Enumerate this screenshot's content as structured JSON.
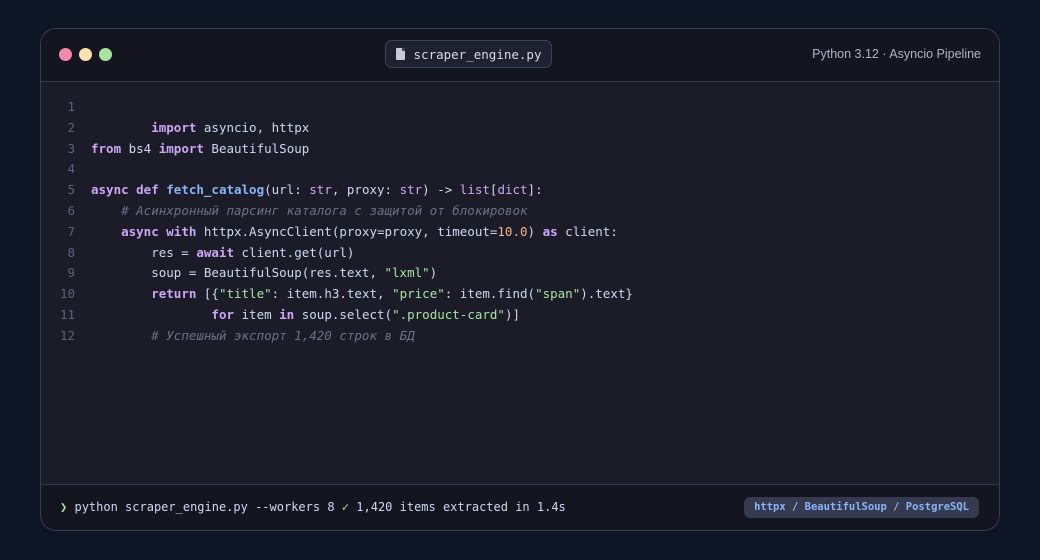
{
  "window": {
    "controls": {
      "close_color": "#f38ba8",
      "minimize_color": "#f9e2af",
      "maximize_color": "#a6e3a1"
    },
    "tab": {
      "icon": "file-icon",
      "filename": "scraper_engine.py"
    },
    "runtime_label": "Python 3.12 · Asyncio Pipeline"
  },
  "editor": {
    "lines": [
      {
        "n": "1",
        "tokens": []
      },
      {
        "n": "2",
        "tokens": [
          {
            "t": "        "
          },
          {
            "t": "import",
            "c": "kw"
          },
          {
            "t": " asyncio, httpx"
          }
        ]
      },
      {
        "n": "3",
        "tokens": [
          {
            "t": "from",
            "c": "kw"
          },
          {
            "t": " bs4 "
          },
          {
            "t": "import",
            "c": "kw"
          },
          {
            "t": " BeautifulSoup"
          }
        ]
      },
      {
        "n": "4",
        "tokens": []
      },
      {
        "n": "5",
        "tokens": [
          {
            "t": "async def",
            "c": "kw"
          },
          {
            "t": " "
          },
          {
            "t": "fetch_catalog",
            "c": "fn"
          },
          {
            "t": "(url: "
          },
          {
            "t": "str",
            "c": "ty"
          },
          {
            "t": ", proxy: "
          },
          {
            "t": "str",
            "c": "ty"
          },
          {
            "t": ") -> "
          },
          {
            "t": "list",
            "c": "ty"
          },
          {
            "t": "["
          },
          {
            "t": "dict",
            "c": "ty"
          },
          {
            "t": "]:"
          }
        ]
      },
      {
        "n": "6",
        "tokens": [
          {
            "t": "    "
          },
          {
            "t": "# Асинхронный парсинг каталога с защитой от блокировок",
            "c": "cmt"
          }
        ]
      },
      {
        "n": "7",
        "tokens": [
          {
            "t": "    "
          },
          {
            "t": "async with",
            "c": "kw"
          },
          {
            "t": " httpx.AsyncClient(proxy=proxy, timeout="
          },
          {
            "t": "10.0",
            "c": "num"
          },
          {
            "t": ") "
          },
          {
            "t": "as",
            "c": "kw"
          },
          {
            "t": " client:"
          }
        ]
      },
      {
        "n": "8",
        "tokens": [
          {
            "t": "        res = "
          },
          {
            "t": "await",
            "c": "kw"
          },
          {
            "t": " client.get(url)"
          }
        ]
      },
      {
        "n": "9",
        "tokens": [
          {
            "t": "        soup = BeautifulSoup(res.text, "
          },
          {
            "t": "\"lxml\"",
            "c": "str"
          },
          {
            "t": ")"
          }
        ]
      },
      {
        "n": "10",
        "tokens": [
          {
            "t": "        "
          },
          {
            "t": "return",
            "c": "kw"
          },
          {
            "t": " [{"
          },
          {
            "t": "\"title\"",
            "c": "str"
          },
          {
            "t": ": item.h3.text, "
          },
          {
            "t": "\"price\"",
            "c": "str"
          },
          {
            "t": ": item.find("
          },
          {
            "t": "\"span\"",
            "c": "str"
          },
          {
            "t": ").text}"
          }
        ]
      },
      {
        "n": "11",
        "tokens": [
          {
            "t": "                "
          },
          {
            "t": "for",
            "c": "kw"
          },
          {
            "t": " item "
          },
          {
            "t": "in",
            "c": "kw"
          },
          {
            "t": " soup.select("
          },
          {
            "t": "\".product-card\"",
            "c": "str"
          },
          {
            "t": ")]"
          }
        ]
      },
      {
        "n": "12",
        "tokens": [
          {
            "t": "        "
          },
          {
            "t": "# Успешный экспорт 1,420 строк в БД",
            "c": "cmt"
          }
        ]
      }
    ]
  },
  "footer": {
    "prompt_symbol": "❯",
    "command": "python scraper_engine.py --workers 8",
    "check": "✓",
    "result": "1,420 items extracted in 1.4s",
    "stack_badge": "httpx / BeautifulSoup / PostgreSQL"
  }
}
